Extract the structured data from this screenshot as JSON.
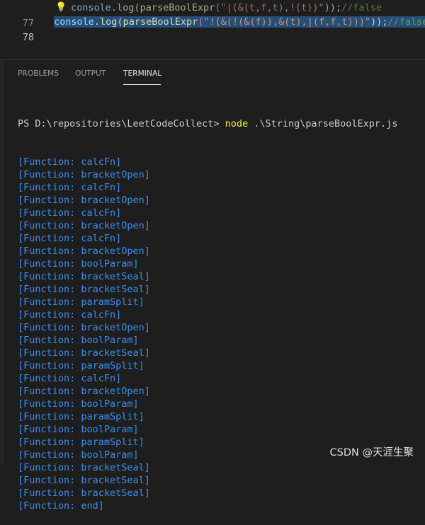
{
  "editor": {
    "line1": {
      "number": "77",
      "ident": "console",
      "dot": ".",
      "method": "log",
      "open": "(",
      "func": "parseBoolExpr",
      "open2": "(",
      "string": "\"|(&(t,f,t),!(t))\"",
      "close": "));",
      "comment": "//false"
    },
    "line2": {
      "number": "78",
      "ident": "console",
      "dot": ".",
      "method": "log",
      "open": "(",
      "func": "parseBoolExpr",
      "open2": "(",
      "string": "\"!(&(!(&(f)),&(t),|(f,f,t)))\"",
      "close": "));",
      "comment": "//false"
    }
  },
  "panel": {
    "tabs": [
      {
        "label": "PROBLEMS"
      },
      {
        "label": "OUTPUT"
      },
      {
        "label": "TERMINAL"
      }
    ]
  },
  "terminal": {
    "prompt": "PS D:\\repositories\\LeetCodeCollect> ",
    "command": "node",
    "args": " .\\String\\parseBoolExpr.js",
    "output": [
      "[Function: calcFn]",
      "[Function: bracketOpen]",
      "[Function: calcFn]",
      "[Function: bracketOpen]",
      "[Function: calcFn]",
      "[Function: bracketOpen]",
      "[Function: calcFn]",
      "[Function: bracketOpen]",
      "[Function: boolParam]",
      "[Function: bracketSeal]",
      "[Function: bracketSeal]",
      "[Function: paramSplit]",
      "[Function: calcFn]",
      "[Function: bracketOpen]",
      "[Function: boolParam]",
      "[Function: bracketSeal]",
      "[Function: paramSplit]",
      "[Function: calcFn]",
      "[Function: bracketOpen]",
      "[Function: boolParam]",
      "[Function: paramSplit]",
      "[Function: boolParam]",
      "[Function: paramSplit]",
      "[Function: boolParam]",
      "[Function: bracketSeal]",
      "[Function: bracketSeal]",
      "[Function: bracketSeal]",
      "[Function: end]"
    ]
  },
  "watermark": "CSDN @天涯生聚",
  "colors": {
    "background": "#1e1e1e",
    "terminal_output": "#3b8eea",
    "command": "#f5f543",
    "string": "#ce9178",
    "comment": "#6a9955",
    "selection": "#264f78"
  },
  "icons": {
    "lightbulb": "lightbulb-icon"
  }
}
